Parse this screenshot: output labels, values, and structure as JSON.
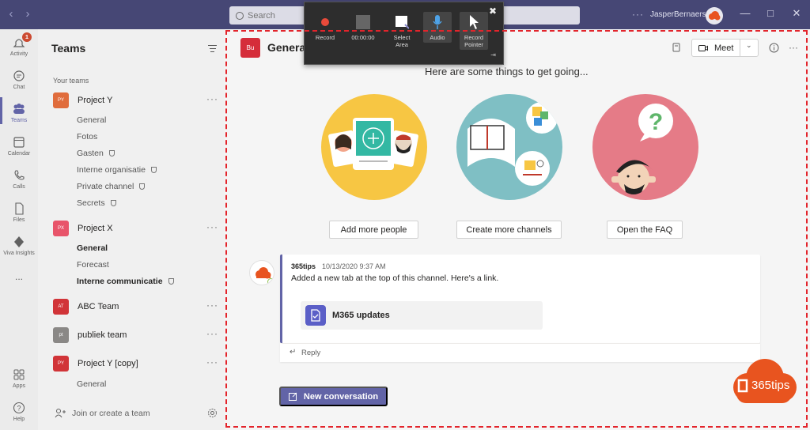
{
  "titlebar": {
    "search_placeholder": "Search",
    "username": "JasperBernaers"
  },
  "recorder": {
    "items": [
      {
        "label": "Record"
      },
      {
        "label": "00:00:00"
      },
      {
        "label": "Select Area"
      },
      {
        "label": "Audio"
      },
      {
        "label": "Record Pointer"
      }
    ]
  },
  "rail": {
    "items": [
      {
        "label": "Activity",
        "badge": "1"
      },
      {
        "label": "Chat"
      },
      {
        "label": "Teams"
      },
      {
        "label": "Calendar"
      },
      {
        "label": "Calls"
      },
      {
        "label": "Files"
      },
      {
        "label": "Viva Insights"
      },
      {
        "label": "..."
      },
      {
        "label": "Apps"
      },
      {
        "label": "Help"
      }
    ]
  },
  "teams_pane": {
    "title": "Teams",
    "section_label": "Your teams",
    "teams": [
      {
        "initials": "PY",
        "name": "Project Y",
        "color": "#e06c3c"
      },
      {
        "initials": "PX",
        "name": "Project X",
        "color": "#e8546a"
      },
      {
        "initials": "AT",
        "name": "ABC Team",
        "color": "#d13438"
      },
      {
        "initials": "pt",
        "name": "publiek team",
        "color": "#8a8886"
      },
      {
        "initials": "PY",
        "name": "Project Y [copy]",
        "color": "#d13438"
      }
    ],
    "channels_py": [
      "General",
      "Fotos",
      "Gasten",
      "Interne organisatie",
      "Private channel",
      "Secrets"
    ],
    "channels_px": [
      "General",
      "Forecast",
      "Interne communicatie"
    ],
    "channels_pyc": [
      "General"
    ],
    "join_label": "Join or create a team"
  },
  "channel": {
    "tile": "Bu",
    "title": "Genera",
    "meet_label": "Meet"
  },
  "welcome": {
    "heading": "Here are some things to get going...",
    "actions": [
      "Add more people",
      "Create more channels",
      "Open the FAQ"
    ]
  },
  "post": {
    "author": "365tips",
    "time": "10/13/2020 9:37 AM",
    "text": "Added a new tab at the top of this channel. Here's a link.",
    "link_title": "M365 updates",
    "reply_label": "Reply"
  },
  "new_conversation_label": "New conversation",
  "brand_text": "365tips"
}
